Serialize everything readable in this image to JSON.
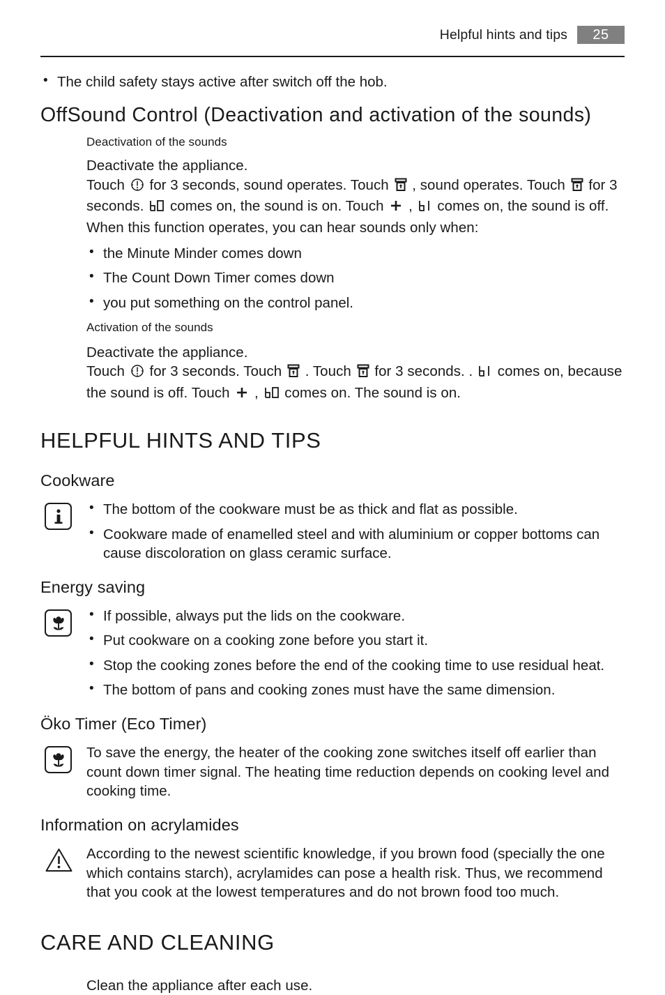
{
  "header": {
    "title": "Helpful hints and tips",
    "page_number": "25",
    "badge_color": "#808080",
    "rule_color": "#1a1a1a"
  },
  "top_bullet": "The child safety stays active after switch off the hob.",
  "offsound": {
    "heading": "OffSound Control (Deactivation and activation of the sounds)",
    "deactivation": {
      "subheading": "Deactivation of the sounds",
      "line1": "Deactivate the appliance.",
      "para_part1": "Touch ",
      "para_part2": " for 3 seconds, sound operates. Touch ",
      "para_part3": " , sound operates. Touch ",
      "para_part4": " for 3 seconds. ",
      "para_part5": " comes on, the sound is on. Touch ",
      "para_part6": " , ",
      "para_part7": " comes on, the sound is off.",
      "line_when": "When this function operates, you can hear sounds only when:",
      "bullets": [
        "the Minute Minder comes down",
        "The Count Down Timer comes down",
        "you put something on the control panel."
      ]
    },
    "activation": {
      "subheading": "Activation of the sounds",
      "line1": "Deactivate the appliance.",
      "para_part1": "Touch ",
      "para_part2": " for 3 seconds. Touch ",
      "para_part3": " . Touch ",
      "para_part4": " for 3 seconds. . ",
      "para_part5": " comes on, because the sound is off. Touch ",
      "para_part6": " , ",
      "para_part7": " comes on. The sound is on."
    }
  },
  "helpful_hints": {
    "heading": "HELPFUL HINTS AND TIPS",
    "cookware": {
      "heading": "Cookware",
      "icon": "info-icon",
      "bullets": [
        "The bottom of the cookware must be as thick and flat as possible.",
        "Cookware made of enamelled steel and with aluminium or copper bottoms can cause discoloration on glass ceramic surface."
      ]
    },
    "energy_saving": {
      "heading": "Energy saving",
      "icon": "eco-flower-icon",
      "bullets": [
        "If possible, always put the lids on the cookware.",
        "Put cookware on a cooking zone before you start it.",
        "Stop the cooking zones before the end of the cooking time to use residual heat.",
        "The bottom of pans and cooking zones must have the same dimension."
      ]
    },
    "oko_timer": {
      "heading": "Öko Timer (Eco Timer)",
      "icon": "eco-flower-icon",
      "text": "To save the energy, the heater of the cooking zone switches itself off earlier than count down timer signal. The heating time reduction depends on cooking level and cooking time."
    },
    "acrylamides": {
      "heading": "Information on acrylamides",
      "icon": "warning-triangle-icon",
      "text": "According to the newest scientific knowledge, if you brown food (specially the one which contains starch), acrylamides can pose a health risk. Thus, we recommend that you cook at the lowest temperatures and do not brown food too much."
    }
  },
  "care_cleaning": {
    "heading": "CARE AND CLEANING",
    "text": "Clean the appliance after each use."
  },
  "symbols": {
    "timer": "timer-clock-icon",
    "lock": "lock-icon",
    "plus": "plus-icon",
    "display_b0": "b0",
    "display_b1": "b1"
  }
}
